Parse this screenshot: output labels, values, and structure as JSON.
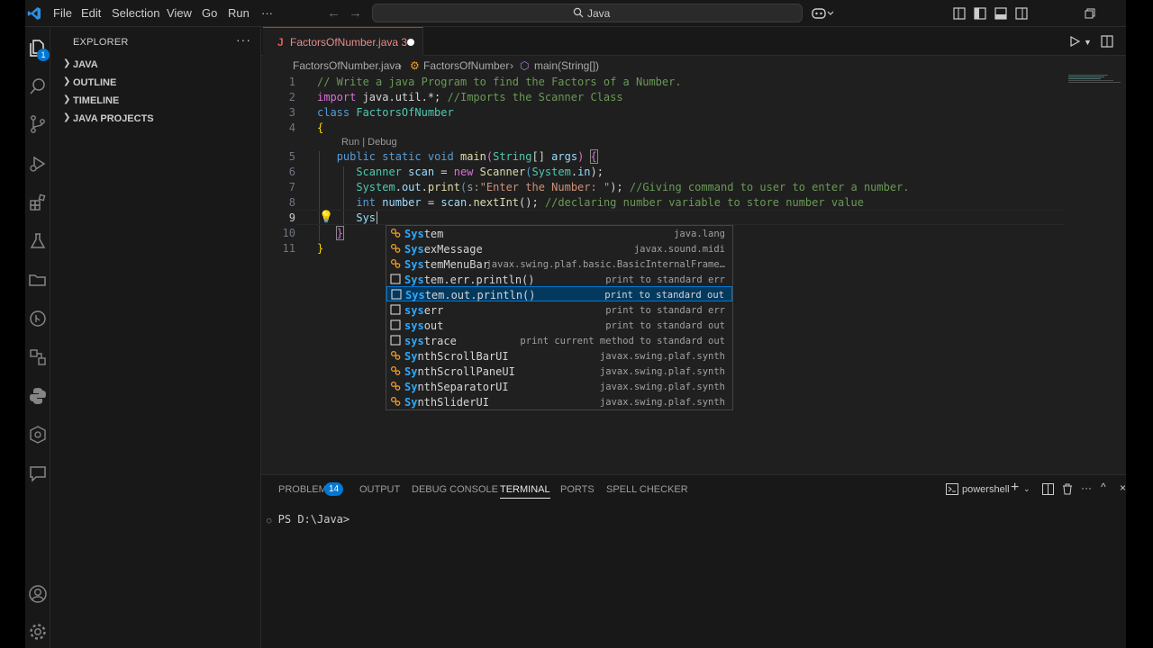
{
  "titlebar": {
    "menu": [
      "File",
      "Edit",
      "Selection",
      "View",
      "Go",
      "Run",
      "···"
    ],
    "search_text": "Java"
  },
  "activity": {
    "explorer_badge": "1"
  },
  "sidebar": {
    "title": "EXPLORER",
    "more": "···",
    "sections": [
      "JAVA",
      "OUTLINE",
      "TIMELINE",
      "JAVA PROJECTS"
    ]
  },
  "editor": {
    "tab": {
      "icon_letter": "J",
      "label": "FactorsOfNumber.java 3"
    },
    "breadcrumb": {
      "file": "FactorsOfNumber.java",
      "class": "FactorsOfNumber",
      "method": "main(String[])"
    },
    "line_numbers": [
      "1",
      "2",
      "3",
      "4",
      "5",
      "6",
      "7",
      "8",
      "9",
      "10",
      "11"
    ],
    "codelens": "Run | Debug",
    "lines": {
      "l1_comment": "// Write a java Program to find the Factors of a Number.",
      "l2_import": "import",
      "l2_pkg": " java.util.*; ",
      "l2_comment": "//Imports the Scanner Class",
      "l3_kw": "class",
      "l3_name": " FactorsOfNumber",
      "l4_brace": "{",
      "l5_public": "public",
      "l5_static": " static",
      "l5_void": " void",
      "l5_main": " main",
      "l5_paren_open": "(",
      "l5_string": "String",
      "l5_rest": "[] ",
      "l5_args": "args",
      "l5_paren_close": ") ",
      "l5_brace": "{",
      "l6_type": "Scanner",
      "l6_var": " scan",
      "l6_eq": " = ",
      "l6_new": "new",
      "l6_ctor": " Scanner",
      "l6_p1": "(",
      "l6_sys": "System",
      "l6_dot": ".",
      "l6_in": "in",
      "l6_end": ");",
      "l7_sys": "System",
      "l7_dot1": ".",
      "l7_out": "out",
      "l7_dot2": ".",
      "l7_print": "print",
      "l7_p1": "(",
      "l7_hint": "s:",
      "l7_str": "\"Enter the Number: \"",
      "l7_end": "); ",
      "l7_comment": "//Giving command to user to enter a number.",
      "l8_int": "int",
      "l8_var": " number",
      "l8_eq": " = ",
      "l8_scan": "scan",
      "l8_dot": ".",
      "l8_next": "nextInt",
      "l8_end": "(); ",
      "l8_comment": "//declaring number variable to store number value",
      "l9_typed": "Sys",
      "l10_brace": "}",
      "l11_brace": "}"
    }
  },
  "suggest": [
    {
      "match": "Sys",
      "rest": "tem",
      "detail": "java.lang",
      "kind": "class"
    },
    {
      "match": "Sys",
      "rest": "exMessage",
      "detail": "javax.sound.midi",
      "kind": "class"
    },
    {
      "match": "Sys",
      "rest": "temMenuBar",
      "detail": "javax.swing.plaf.basic.BasicInternalFrame…",
      "kind": "class"
    },
    {
      "match": "Sys",
      "rest": "tem.err.println()",
      "detail": "print to standard err",
      "kind": "snippet"
    },
    {
      "match": "Sys",
      "rest": "tem.out.println()",
      "detail": "print to standard out",
      "kind": "snippet"
    },
    {
      "match": "sys",
      "rest": "err",
      "detail": "print to standard err",
      "kind": "snippet"
    },
    {
      "match": "sys",
      "rest": "out",
      "detail": "print to standard out",
      "kind": "snippet"
    },
    {
      "match": "sys",
      "rest": "trace",
      "detail": "print current method to standard out",
      "kind": "snippet"
    },
    {
      "match": "Sy",
      "rest": "nthScrollBarUI",
      "detail": "javax.swing.plaf.synth",
      "kind": "class"
    },
    {
      "match": "Sy",
      "rest": "nthScrollPaneUI",
      "detail": "javax.swing.plaf.synth",
      "kind": "class"
    },
    {
      "match": "Sy",
      "rest": "nthSeparatorUI",
      "detail": "javax.swing.plaf.synth",
      "kind": "class"
    },
    {
      "match": "Sy",
      "rest": "nthSliderUI",
      "detail": "javax.swing.plaf.synth",
      "kind": "class"
    }
  ],
  "panel": {
    "tabs": [
      "PROBLEMS",
      "OUTPUT",
      "DEBUG CONSOLE",
      "TERMINAL",
      "PORTS",
      "SPELL CHECKER"
    ],
    "problems_count": "14",
    "shell": "powershell",
    "prompt": "PS D:\\Java>"
  },
  "colors": {
    "accent": "#0078d4",
    "background": "#1f1f1f",
    "sidebar": "#181818"
  }
}
